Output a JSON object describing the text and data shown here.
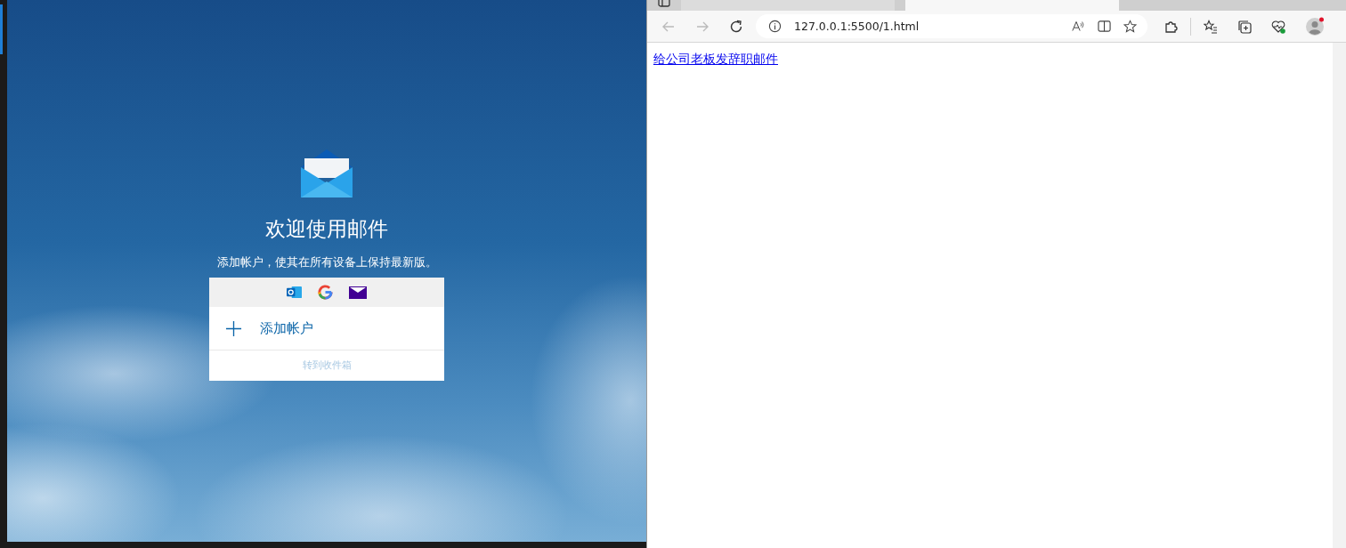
{
  "mail_app": {
    "title": "欢迎使用邮件",
    "subtitle": "添加帐户，使其在所有设备上保持最新版。",
    "add_account": "添加帐户",
    "go_to_inbox": "转到收件箱"
  },
  "browser": {
    "tabs": [
      {
        "selected": false
      },
      {
        "selected": true
      }
    ],
    "address": "127.0.0.1:5500/1.html",
    "page_link": "给公司老板发辞职邮件"
  }
}
